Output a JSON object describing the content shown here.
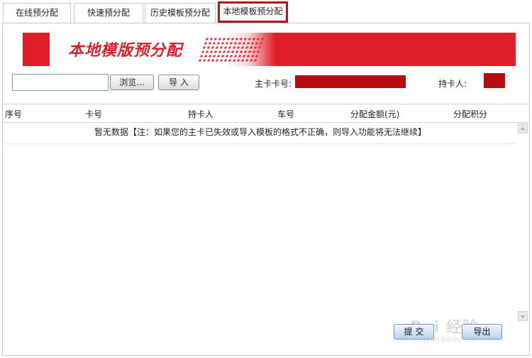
{
  "tabs": [
    {
      "label": "在线预分配"
    },
    {
      "label": "快速预分配"
    },
    {
      "label": "历史模板预分配"
    },
    {
      "label": "本地模板预分配",
      "active": true
    }
  ],
  "banner": {
    "title": "本地模版预分配"
  },
  "toolbar": {
    "file_value": "",
    "browse_label": "浏览...",
    "import_label": "导 入",
    "main_card_label": "主卡卡号:",
    "holder_label": "持卡人:"
  },
  "table": {
    "columns": [
      "序号",
      "卡号",
      "持卡人",
      "车号",
      "分配金额(元)",
      "分配积分"
    ],
    "empty_text": "暂无数据【注：如果您的主卡已失效或导入模板的格式不正确，则导入功能将无法继续】"
  },
  "actions": {
    "submit_label": "提 交",
    "export_label": "导出"
  },
  "watermark": {
    "text": "Bai 经验",
    "sub": "jingyan.baidu.com"
  },
  "colors": {
    "brand_red": "#e01e2a",
    "redaction": "#b80b0b",
    "active_tab_border": "#b3131c"
  }
}
